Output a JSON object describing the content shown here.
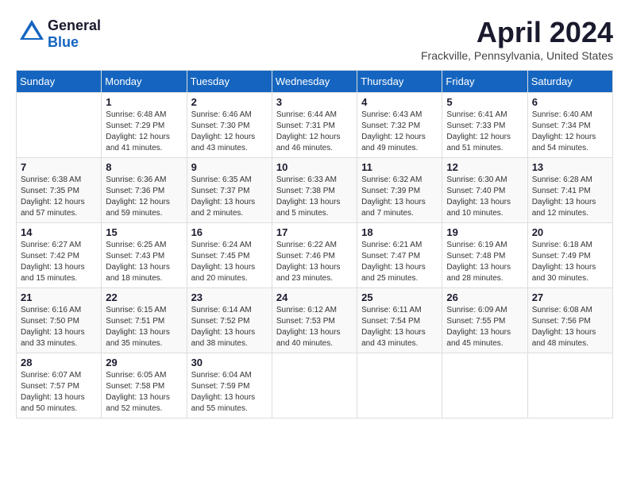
{
  "logo": {
    "general": "General",
    "blue": "Blue"
  },
  "title": "April 2024",
  "location": "Frackville, Pennsylvania, United States",
  "weekdays": [
    "Sunday",
    "Monday",
    "Tuesday",
    "Wednesday",
    "Thursday",
    "Friday",
    "Saturday"
  ],
  "weeks": [
    [
      {
        "day": "",
        "sunrise": "",
        "sunset": "",
        "daylight": ""
      },
      {
        "day": "1",
        "sunrise": "Sunrise: 6:48 AM",
        "sunset": "Sunset: 7:29 PM",
        "daylight": "Daylight: 12 hours and 41 minutes."
      },
      {
        "day": "2",
        "sunrise": "Sunrise: 6:46 AM",
        "sunset": "Sunset: 7:30 PM",
        "daylight": "Daylight: 12 hours and 43 minutes."
      },
      {
        "day": "3",
        "sunrise": "Sunrise: 6:44 AM",
        "sunset": "Sunset: 7:31 PM",
        "daylight": "Daylight: 12 hours and 46 minutes."
      },
      {
        "day": "4",
        "sunrise": "Sunrise: 6:43 AM",
        "sunset": "Sunset: 7:32 PM",
        "daylight": "Daylight: 12 hours and 49 minutes."
      },
      {
        "day": "5",
        "sunrise": "Sunrise: 6:41 AM",
        "sunset": "Sunset: 7:33 PM",
        "daylight": "Daylight: 12 hours and 51 minutes."
      },
      {
        "day": "6",
        "sunrise": "Sunrise: 6:40 AM",
        "sunset": "Sunset: 7:34 PM",
        "daylight": "Daylight: 12 hours and 54 minutes."
      }
    ],
    [
      {
        "day": "7",
        "sunrise": "Sunrise: 6:38 AM",
        "sunset": "Sunset: 7:35 PM",
        "daylight": "Daylight: 12 hours and 57 minutes."
      },
      {
        "day": "8",
        "sunrise": "Sunrise: 6:36 AM",
        "sunset": "Sunset: 7:36 PM",
        "daylight": "Daylight: 12 hours and 59 minutes."
      },
      {
        "day": "9",
        "sunrise": "Sunrise: 6:35 AM",
        "sunset": "Sunset: 7:37 PM",
        "daylight": "Daylight: 13 hours and 2 minutes."
      },
      {
        "day": "10",
        "sunrise": "Sunrise: 6:33 AM",
        "sunset": "Sunset: 7:38 PM",
        "daylight": "Daylight: 13 hours and 5 minutes."
      },
      {
        "day": "11",
        "sunrise": "Sunrise: 6:32 AM",
        "sunset": "Sunset: 7:39 PM",
        "daylight": "Daylight: 13 hours and 7 minutes."
      },
      {
        "day": "12",
        "sunrise": "Sunrise: 6:30 AM",
        "sunset": "Sunset: 7:40 PM",
        "daylight": "Daylight: 13 hours and 10 minutes."
      },
      {
        "day": "13",
        "sunrise": "Sunrise: 6:28 AM",
        "sunset": "Sunset: 7:41 PM",
        "daylight": "Daylight: 13 hours and 12 minutes."
      }
    ],
    [
      {
        "day": "14",
        "sunrise": "Sunrise: 6:27 AM",
        "sunset": "Sunset: 7:42 PM",
        "daylight": "Daylight: 13 hours and 15 minutes."
      },
      {
        "day": "15",
        "sunrise": "Sunrise: 6:25 AM",
        "sunset": "Sunset: 7:43 PM",
        "daylight": "Daylight: 13 hours and 18 minutes."
      },
      {
        "day": "16",
        "sunrise": "Sunrise: 6:24 AM",
        "sunset": "Sunset: 7:45 PM",
        "daylight": "Daylight: 13 hours and 20 minutes."
      },
      {
        "day": "17",
        "sunrise": "Sunrise: 6:22 AM",
        "sunset": "Sunset: 7:46 PM",
        "daylight": "Daylight: 13 hours and 23 minutes."
      },
      {
        "day": "18",
        "sunrise": "Sunrise: 6:21 AM",
        "sunset": "Sunset: 7:47 PM",
        "daylight": "Daylight: 13 hours and 25 minutes."
      },
      {
        "day": "19",
        "sunrise": "Sunrise: 6:19 AM",
        "sunset": "Sunset: 7:48 PM",
        "daylight": "Daylight: 13 hours and 28 minutes."
      },
      {
        "day": "20",
        "sunrise": "Sunrise: 6:18 AM",
        "sunset": "Sunset: 7:49 PM",
        "daylight": "Daylight: 13 hours and 30 minutes."
      }
    ],
    [
      {
        "day": "21",
        "sunrise": "Sunrise: 6:16 AM",
        "sunset": "Sunset: 7:50 PM",
        "daylight": "Daylight: 13 hours and 33 minutes."
      },
      {
        "day": "22",
        "sunrise": "Sunrise: 6:15 AM",
        "sunset": "Sunset: 7:51 PM",
        "daylight": "Daylight: 13 hours and 35 minutes."
      },
      {
        "day": "23",
        "sunrise": "Sunrise: 6:14 AM",
        "sunset": "Sunset: 7:52 PM",
        "daylight": "Daylight: 13 hours and 38 minutes."
      },
      {
        "day": "24",
        "sunrise": "Sunrise: 6:12 AM",
        "sunset": "Sunset: 7:53 PM",
        "daylight": "Daylight: 13 hours and 40 minutes."
      },
      {
        "day": "25",
        "sunrise": "Sunrise: 6:11 AM",
        "sunset": "Sunset: 7:54 PM",
        "daylight": "Daylight: 13 hours and 43 minutes."
      },
      {
        "day": "26",
        "sunrise": "Sunrise: 6:09 AM",
        "sunset": "Sunset: 7:55 PM",
        "daylight": "Daylight: 13 hours and 45 minutes."
      },
      {
        "day": "27",
        "sunrise": "Sunrise: 6:08 AM",
        "sunset": "Sunset: 7:56 PM",
        "daylight": "Daylight: 13 hours and 48 minutes."
      }
    ],
    [
      {
        "day": "28",
        "sunrise": "Sunrise: 6:07 AM",
        "sunset": "Sunset: 7:57 PM",
        "daylight": "Daylight: 13 hours and 50 minutes."
      },
      {
        "day": "29",
        "sunrise": "Sunrise: 6:05 AM",
        "sunset": "Sunset: 7:58 PM",
        "daylight": "Daylight: 13 hours and 52 minutes."
      },
      {
        "day": "30",
        "sunrise": "Sunrise: 6:04 AM",
        "sunset": "Sunset: 7:59 PM",
        "daylight": "Daylight: 13 hours and 55 minutes."
      },
      {
        "day": "",
        "sunrise": "",
        "sunset": "",
        "daylight": ""
      },
      {
        "day": "",
        "sunrise": "",
        "sunset": "",
        "daylight": ""
      },
      {
        "day": "",
        "sunrise": "",
        "sunset": "",
        "daylight": ""
      },
      {
        "day": "",
        "sunrise": "",
        "sunset": "",
        "daylight": ""
      }
    ]
  ]
}
